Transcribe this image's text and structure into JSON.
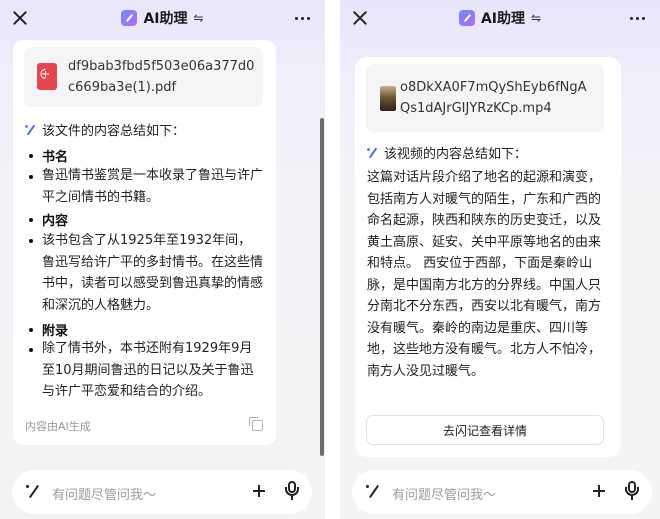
{
  "left": {
    "header": {
      "title": "AI助理",
      "switch_glyph": "⇋"
    },
    "file": {
      "name": "df9bab3fbd5f503e06a377d0c669ba3e(1).pdf"
    },
    "summary_heading": "该文件的内容总结如下：",
    "sections": [
      {
        "title": "书名",
        "text": "鲁迅情书鉴赏是一本收录了鲁迅与许广平之间情书的书籍。"
      },
      {
        "title": "内容",
        "text": "该书包含了从1925年至1932年间，鲁迅写给许广平的多封情书。在这些情书中，读者可以感受到鲁迅真挚的情感和深沉的人格魅力。"
      },
      {
        "title": "附录",
        "text": "除了情书外，本书还附有1929年9月至10月期间鲁迅的日记以及关于鲁迅与许广平恋爱和结合的介绍。"
      }
    ],
    "footer_note": "内容由AI生成",
    "input": {
      "placeholder": "有问题尽管问我～"
    }
  },
  "right": {
    "header": {
      "title": "AI助理",
      "switch_glyph": "⇋"
    },
    "file": {
      "name": "o8DkXA0F7mQyShEyb6fNgAQs1dAJrGIJYRzKCp.mp4"
    },
    "summary_heading": "该视频的内容总结如下：",
    "paragraph": "这篇对话片段介绍了地名的起源和演变，包括南方人对暖气的陌生，广东和广西的命名起源，陕西和陕东的历史变迁，以及黄土高原、延安、关中平原等地名的由来和特点。 西安位于西部，下面是秦岭山脉，是中国南方北方的分界线。中国人只分南北不分东西，西安以北有暖气，南方没有暖气。秦岭的南边是重庆、四川等地，这些地方没有暖气。北方人不怕冷，南方人没见过暖气。",
    "detail_button": "去闪记查看详情",
    "input": {
      "placeholder": "有问题尽管问我～"
    }
  },
  "colors": {
    "accent": "#4a6cf7",
    "pdf_red": "#e6474f",
    "muted_text": "#9c9c9c"
  }
}
